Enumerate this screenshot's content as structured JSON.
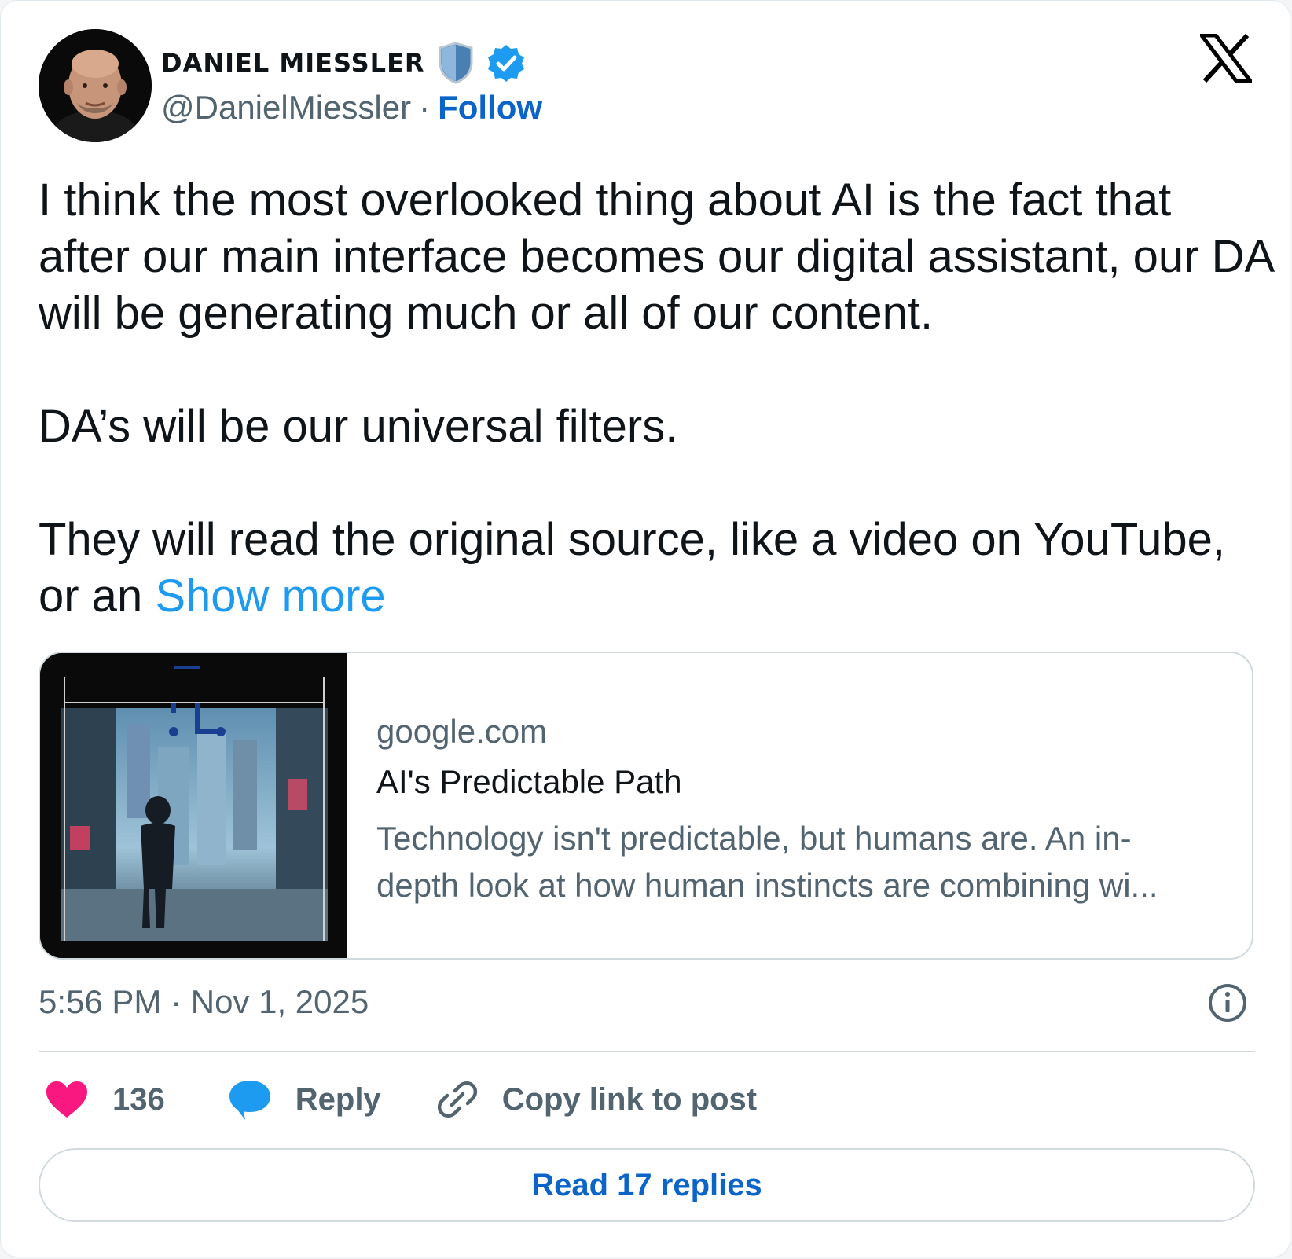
{
  "author": {
    "display_name": "DANIEL MIESSLER",
    "handle": "@DanielMiessler",
    "separator": "·",
    "follow_label": "Follow",
    "verified": true
  },
  "tweet": {
    "paragraphs": [
      "I think the most overlooked thing about AI is the fact that after our main interface becomes our digital assistant, our DA will be generating much or all of our content.",
      "DA’s will be our universal filters.",
      "They will read the original source, like a video on YouTube, or an"
    ],
    "show_more_label": "Show more"
  },
  "link_card": {
    "image_caption": "AI's Predictable Path",
    "domain": "google.com",
    "title": "AI's Predictable Path",
    "description": "Technology isn't predictable, but humans are. An in-depth look at how human instincts are combining wi..."
  },
  "meta": {
    "timestamp": "5:56 PM · Nov 1, 2025"
  },
  "actions": {
    "like_count": "136",
    "reply_label": "Reply",
    "copy_link_label": "Copy link to post"
  },
  "read_replies_label": "Read 17 replies",
  "colors": {
    "link_blue": "#0b64c8",
    "show_more_blue": "#1d9bf0",
    "heart_pink": "#f91880",
    "bubble_blue": "#1d9bf0",
    "muted_text": "#536471"
  }
}
